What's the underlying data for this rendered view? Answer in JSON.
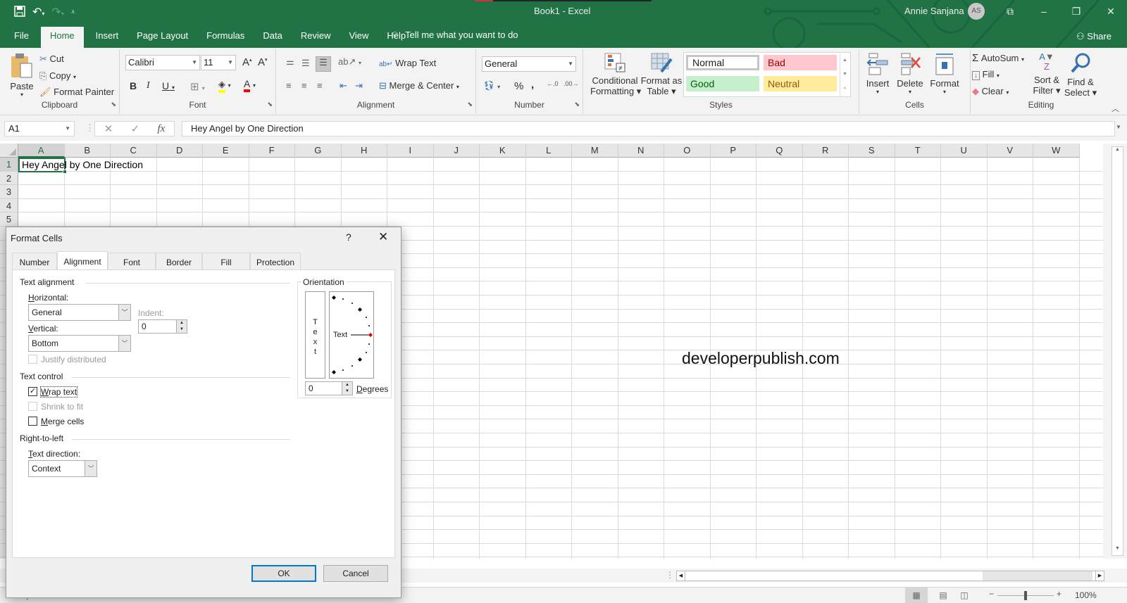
{
  "app": {
    "title": "Book1  -  Excel",
    "user_name": "Annie Sanjana",
    "user_initials": "AS",
    "share_label": "Share",
    "tell_me": "Tell me what you want to do"
  },
  "quick_access": {
    "icons": [
      "save-icon",
      "undo-icon",
      "redo-icon",
      "customize-icon"
    ]
  },
  "window_controls": {
    "ribbon_display": "⧉",
    "minimize": "–",
    "restore": "❐",
    "close": "✕"
  },
  "menu_tabs": [
    "File",
    "Home",
    "Insert",
    "Page Layout",
    "Formulas",
    "Data",
    "Review",
    "View",
    "Help"
  ],
  "active_tab": "Home",
  "ribbon": {
    "clipboard": {
      "label": "Clipboard",
      "paste": "Paste",
      "cut": "Cut",
      "copy": "Copy",
      "format_painter": "Format Painter"
    },
    "font": {
      "label": "Font",
      "font_name": "Calibri",
      "font_size": "11",
      "bold": "B",
      "italic": "I",
      "underline": "U"
    },
    "alignment": {
      "label": "Alignment",
      "wrap_text": "Wrap Text",
      "merge_center": "Merge & Center"
    },
    "number": {
      "label": "Number",
      "format": "General",
      "percent": "%",
      "comma": ","
    },
    "styles": {
      "label": "Styles",
      "conditional_formatting": [
        "Conditional",
        "Formatting ▾"
      ],
      "format_as_table": [
        "Format as",
        "Table ▾"
      ],
      "cells": [
        {
          "name": "Normal",
          "bg": "#ffffff",
          "fg": "#000000"
        },
        {
          "name": "Bad",
          "bg": "#ffc7ce",
          "fg": "#9c0006"
        },
        {
          "name": "Good",
          "bg": "#c6efce",
          "fg": "#006100"
        },
        {
          "name": "Neutral",
          "bg": "#ffeb9c",
          "fg": "#9c5700"
        }
      ]
    },
    "cells": {
      "label": "Cells",
      "insert": "Insert",
      "delete": "Delete",
      "format": "Format"
    },
    "editing": {
      "label": "Editing",
      "autosum": "AutoSum",
      "fill": "Fill",
      "clear": "Clear",
      "sort_filter": [
        "Sort &",
        "Filter ▾"
      ],
      "find_select": [
        "Find &",
        "Select ▾"
      ]
    }
  },
  "formula_bar": {
    "name_box": "A1",
    "fx": "fx",
    "value": "Hey Angel by One Direction"
  },
  "sheet": {
    "columns": [
      "A",
      "B",
      "C",
      "D",
      "E",
      "F",
      "G",
      "H",
      "I",
      "J",
      "K",
      "L",
      "M",
      "N",
      "O",
      "P",
      "Q",
      "R",
      "S",
      "T",
      "U",
      "V",
      "W"
    ],
    "rows": [
      "1",
      "2",
      "3",
      "4",
      "5"
    ],
    "selected_cell": "A1",
    "cell_A1": "Hey Angel by One Direction"
  },
  "watermark": "developerpublish.com",
  "status_bar": {
    "status": "Ready",
    "zoom": "100%"
  },
  "dialog": {
    "title": "Format Cells",
    "help": "?",
    "close": "✕",
    "tabs": [
      "Number",
      "Alignment",
      "Font",
      "Border",
      "Fill",
      "Protection"
    ],
    "active_tab": "Alignment",
    "text_alignment": {
      "heading": "Text alignment",
      "horizontal_label": "Horizontal:",
      "horizontal_value": "General",
      "vertical_label": "Vertical:",
      "vertical_value": "Bottom",
      "indent_label": "Indent:",
      "indent_value": "0",
      "justify_distributed": "Justify distributed",
      "justify_distributed_checked": false
    },
    "text_control": {
      "heading": "Text control",
      "wrap_text": "Wrap text",
      "wrap_text_checked": true,
      "shrink_to_fit": "Shrink to fit",
      "shrink_to_fit_checked": false,
      "merge_cells": "Merge cells",
      "merge_cells_checked": false
    },
    "right_to_left": {
      "heading": "Right-to-left",
      "text_direction_label": "Text direction:",
      "text_direction_value": "Context"
    },
    "orientation": {
      "heading": "Orientation",
      "vertical_text": [
        "T",
        "e",
        "x",
        "t"
      ],
      "dial_text": "Text",
      "degrees_value": "0",
      "degrees_label": "Degrees"
    },
    "ok": "OK",
    "cancel": "Cancel"
  }
}
